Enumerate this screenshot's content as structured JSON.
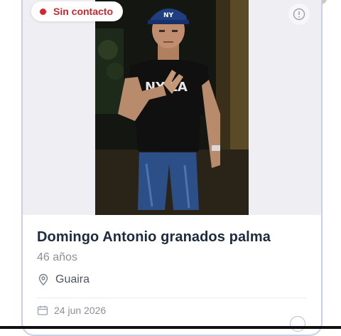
{
  "card": {
    "status_label": "Sin contacto",
    "name": "Domingo Antonio granados palma",
    "age": "46 años",
    "location": "Guaira",
    "date": "24 jun 2026",
    "shirt_text": "NY LA"
  },
  "icons": {
    "status": "status-dot-icon",
    "info": "info-icon",
    "location": "map-pin-icon",
    "date": "calendar-icon"
  },
  "colors": {
    "status": "#d7262e",
    "card_border": "#c9cfe8",
    "name_text": "#1e2a3e"
  }
}
